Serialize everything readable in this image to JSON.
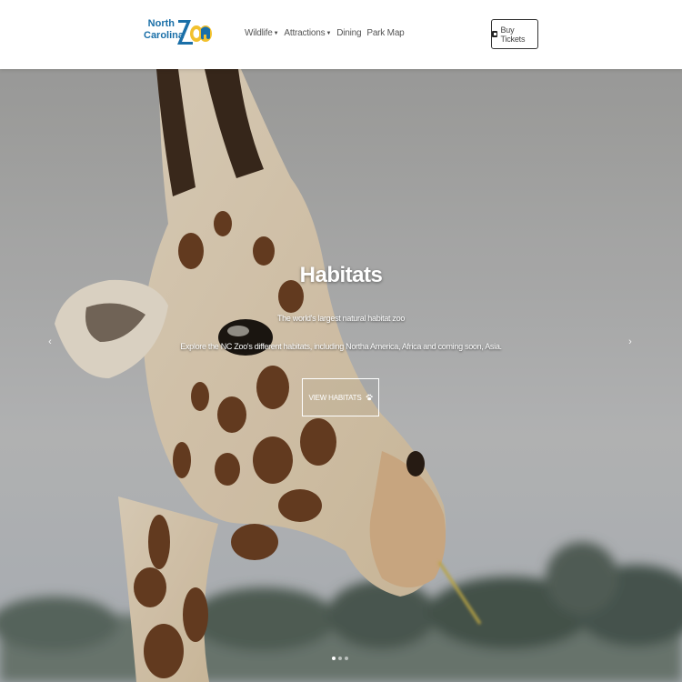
{
  "header": {
    "logo": {
      "line1": "North",
      "line2": "Carolina",
      "wordmark": "ZOO",
      "wordmark_color": "#1a6fa8",
      "accent_color": "#f2c12e"
    },
    "nav": [
      {
        "label": "Wildlife",
        "has_dropdown": true
      },
      {
        "label": "Attractions",
        "has_dropdown": true
      },
      {
        "label": "Dining",
        "has_dropdown": false
      },
      {
        "label": "Park Map",
        "has_dropdown": false
      }
    ],
    "buy_tickets": {
      "label": "Buy Tickets",
      "icon": "ticket-icon"
    }
  },
  "hero": {
    "title": "Habitats",
    "subtitle": "The world's largest natural habitat zoo",
    "description": "Explore the NC Zoo's different habitats, including Northa America, Africa and coming soon, Asia.",
    "cta_label": "VIEW HABITATS",
    "cta_icon": "paw-icon",
    "prev_arrow": "‹",
    "next_arrow": "›",
    "slide_count": 3,
    "active_slide": 1,
    "image_subject": "giraffe"
  }
}
